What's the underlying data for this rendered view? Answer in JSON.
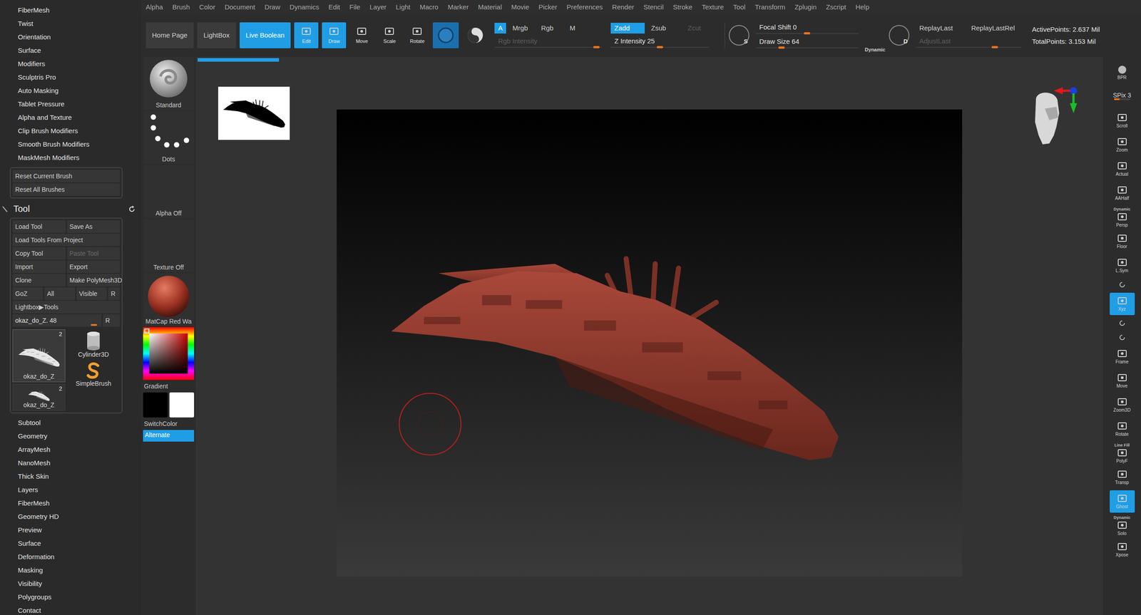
{
  "menu": [
    "Alpha",
    "Brush",
    "Color",
    "Document",
    "Draw",
    "Dynamics",
    "Edit",
    "File",
    "Layer",
    "Light",
    "Macro",
    "Marker",
    "Material",
    "Movie",
    "Picker",
    "Preferences",
    "Render",
    "Stencil",
    "Stroke",
    "Texture",
    "Tool",
    "Transform",
    "Zplugin",
    "Zscript",
    "Help"
  ],
  "toolbar": {
    "nav_buttons": [
      {
        "label": "Home Page",
        "selected": false
      },
      {
        "label": "LightBox",
        "selected": false
      },
      {
        "label": "Live Boolean",
        "selected": true
      }
    ],
    "mode_buttons": [
      {
        "label": "Edit",
        "selected": true
      },
      {
        "label": "Draw",
        "selected": true
      },
      {
        "label": "Move",
        "selected": false
      },
      {
        "label": "Scale",
        "selected": false
      },
      {
        "label": "Rotate",
        "selected": false
      }
    ],
    "color_modes": [
      {
        "label": "A",
        "selected": true
      },
      {
        "label": "Mrgb",
        "selected": false
      },
      {
        "label": "Rgb",
        "selected": false
      },
      {
        "label": "M",
        "selected": false
      }
    ],
    "rgb_intensity": {
      "label": "Rgb Intensity",
      "disabled": true,
      "level": 0.95
    },
    "z_modes": [
      {
        "label": "Zadd",
        "selected": true,
        "disabled": false
      },
      {
        "label": "Zsub",
        "selected": false,
        "disabled": false
      },
      {
        "label": "Zcut",
        "selected": false,
        "disabled": true
      }
    ],
    "z_intensity": {
      "label": "Z Intensity",
      "value": "25",
      "level": 0.5
    },
    "focal_shift": {
      "label": "Focal Shift",
      "value": "0",
      "level": 0.5
    },
    "draw_size": {
      "label": "Draw Size",
      "value": "64",
      "level": 0.25
    },
    "focal_icon": "S",
    "draw_icon": "D",
    "dynamic": "Dynamic",
    "replay": [
      {
        "label": "ReplayLast",
        "disabled": false
      },
      {
        "label": "ReplayLastRel",
        "disabled": false
      }
    ],
    "adjust": {
      "label": "AdjustLast",
      "disabled": true,
      "level": 0.75
    },
    "stats": [
      "ActivePoints: 2.637 Mil",
      "TotalPoints: 3.153 Mil"
    ]
  },
  "left_panel": {
    "brush_items": [
      "FiberMesh",
      "Twist",
      "Orientation",
      "Surface",
      "Modifiers",
      "Sculptris Pro",
      "Auto Masking",
      "Tablet Pressure",
      "Alpha and Texture",
      "Clip Brush Modifiers",
      "Smooth Brush Modifiers",
      "MaskMesh Modifiers"
    ],
    "reset_buttons": [
      "Reset Current Brush",
      "Reset All Brushes"
    ],
    "tool_title": "Tool",
    "tool_rows": [
      [
        {
          "label": "Load Tool",
          "disabled": false
        },
        {
          "label": "Save As",
          "disabled": false
        }
      ],
      [
        {
          "label": "Load Tools From Project",
          "disabled": false
        }
      ],
      [
        {
          "label": "Copy Tool",
          "disabled": false
        },
        {
          "label": "Paste Tool",
          "disabled": true
        }
      ],
      [
        {
          "label": "Import",
          "disabled": false
        },
        {
          "label": "Export",
          "disabled": false
        }
      ],
      [
        {
          "label": "Clone",
          "disabled": false
        },
        {
          "label": "Make PolyMesh3D",
          "disabled": false
        }
      ],
      [
        {
          "label": "GoZ",
          "disabled": false
        },
        {
          "label": "All",
          "disabled": false
        },
        {
          "label": "Visible",
          "disabled": false
        },
        {
          "label": "R",
          "disabled": false
        }
      ],
      [
        {
          "label": "Lightbox▶Tools",
          "disabled": false
        }
      ]
    ],
    "tool_slider": {
      "label": "okaz_do_Z. 48",
      "level": 0.95,
      "reset": "R"
    },
    "tools": [
      {
        "label": "okaz_do_Z",
        "badge": "2",
        "kind": "mesh",
        "selected": true
      },
      {
        "label": "Cylinder3D",
        "kind": "cylinder",
        "selected": false
      },
      {
        "label": "SimpleBrush",
        "kind": "brush",
        "selected": false
      },
      {
        "label": "okaz_do_Z",
        "badge": "2",
        "kind": "mesh-small",
        "selected": false
      }
    ],
    "tool_items": [
      "Subtool",
      "Geometry",
      "ArrayMesh",
      "NanoMesh",
      "Thick Skin",
      "Layers",
      "FiberMesh",
      "Geometry HD",
      "Preview",
      "Surface",
      "Deformation",
      "Masking",
      "Visibility",
      "Polygroups",
      "Contact"
    ]
  },
  "thumb_column": {
    "slots": [
      {
        "label": "Standard",
        "kind": "brush"
      },
      {
        "label": "Dots",
        "kind": "stroke"
      },
      {
        "label": "Alpha Off",
        "kind": "empty"
      },
      {
        "label": "Texture Off",
        "kind": "empty"
      },
      {
        "label": "MatCap Red Wa",
        "kind": "material"
      }
    ],
    "gradient": "Gradient",
    "switch_color": "SwitchColor",
    "alternate": {
      "label": "Alternate",
      "selected": true
    }
  },
  "canvas": {
    "progress": 0.09
  },
  "right_shelf": [
    {
      "label": "BPR",
      "kind": "button",
      "selected": false
    },
    {
      "label": "SPix 3",
      "kind": "slider",
      "level": 0.35,
      "selected": false
    },
    {
      "label": "Scroll",
      "kind": "button",
      "selected": false
    },
    {
      "label": "Zoom",
      "kind": "button",
      "selected": false
    },
    {
      "label": "Actual",
      "kind": "button",
      "selected": false
    },
    {
      "label": "AAHalf",
      "kind": "button",
      "selected": false
    },
    {
      "label": "Persp",
      "top": "Dynamic",
      "kind": "button",
      "selected": false
    },
    {
      "label": "Floor",
      "kind": "button",
      "selected": false
    },
    {
      "label": "L.Sym",
      "kind": "button",
      "selected": false
    },
    {
      "label": "",
      "kind": "icon",
      "selected": false
    },
    {
      "label": "Xyz",
      "kind": "button",
      "selected": true
    },
    {
      "label": "",
      "kind": "icon",
      "selected": false
    },
    {
      "label": "",
      "kind": "icon",
      "selected": false
    },
    {
      "label": "Frame",
      "kind": "button",
      "selected": false
    },
    {
      "label": "Move",
      "kind": "button",
      "selected": false
    },
    {
      "label": "Zoom3D",
      "kind": "button",
      "selected": false
    },
    {
      "label": "Rotate",
      "kind": "button",
      "selected": false
    },
    {
      "label": "PolyF",
      "top": "Line Fill",
      "kind": "button",
      "selected": false
    },
    {
      "label": "Transp",
      "kind": "button",
      "selected": false
    },
    {
      "label": "Ghost",
      "kind": "button",
      "selected": true
    },
    {
      "label": "Solo",
      "top": "Dynamic",
      "kind": "button",
      "selected": false
    },
    {
      "label": "Xpose",
      "kind": "button",
      "selected": false
    }
  ]
}
